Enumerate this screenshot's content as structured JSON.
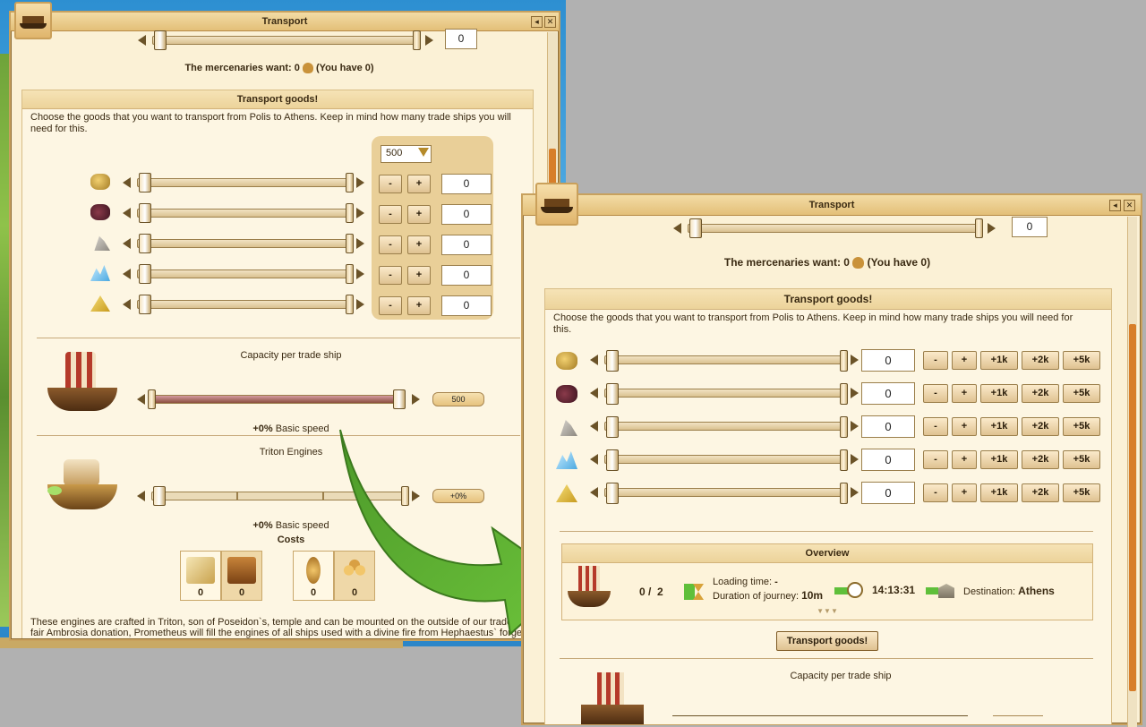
{
  "background": {
    "accent": "#c8a15e",
    "water": "#2d8fd1"
  },
  "window_back": {
    "title": "Transport",
    "mercenaries": {
      "label": "The mercenaries want: 0",
      "suffix": "(You have 0)",
      "value": "0"
    },
    "transport_goods": {
      "title": "Transport goods!",
      "description": "Choose the goods that you want to transport from Polis to Athens. Keep in mind how many trade ships you will need for this.",
      "step_select": "500",
      "minus": "-",
      "plus": "+",
      "rows": [
        {
          "resource": "gold-icon",
          "value": "0"
        },
        {
          "resource": "grapes-icon",
          "value": "0"
        },
        {
          "resource": "marble-icon",
          "value": "0"
        },
        {
          "resource": "crystal-icon",
          "value": "0"
        },
        {
          "resource": "sulfur-icon",
          "value": "0"
        }
      ]
    },
    "capacity": {
      "title": "Capacity per trade ship",
      "value": "500",
      "speed": "+0% Basic speed",
      "speed_bold": "+0%",
      "speed_rest": "Basic speed"
    },
    "triton": {
      "title": "Triton Engines",
      "value": "+0%",
      "speed_bold": "+0%",
      "speed_rest": "Basic speed",
      "costs_label": "Costs",
      "costs": [
        "0",
        "0",
        "0",
        "0"
      ]
    },
    "footer_text_1": "These engines are crafted in Triton, son of Poseidon`s, temple and can be mounted on the outside of our trade ships. For a",
    "footer_text_2": "fair Ambrosia donation, Prometheus will fill the engines of all ships used with a divine fire from Hephaestus` forge, which"
  },
  "window_front": {
    "title": "Transport",
    "mercenaries": {
      "label": "The mercenaries want: 0",
      "suffix": "(You have 0)",
      "value": "0"
    },
    "transport_goods": {
      "title": "Transport goods!",
      "description_1": "Choose the goods that you want to transport from Polis to Athens. Keep in mind how many trade ships you will need for",
      "description_2": "this.",
      "buttons": [
        "-",
        "+",
        "+1k",
        "+2k",
        "+5k"
      ],
      "rows": [
        {
          "resource": "gold-icon",
          "value": "0"
        },
        {
          "resource": "grapes-icon",
          "value": "0"
        },
        {
          "resource": "marble-icon",
          "value": "0"
        },
        {
          "resource": "crystal-icon",
          "value": "0"
        },
        {
          "resource": "sulfur-icon",
          "value": "0"
        }
      ]
    },
    "overview": {
      "title": "Overview",
      "ships": "0 /",
      "ships_total": "2",
      "loading_label": "Loading time:",
      "loading_value": "-",
      "journey_label": "Duration of journey:",
      "journey_value": "10m",
      "arrival": "14:13:31",
      "destination_label": "Destination:",
      "destination_value": "Athens"
    },
    "submit": "Transport goods!",
    "capacity_title": "Capacity per trade ship"
  }
}
